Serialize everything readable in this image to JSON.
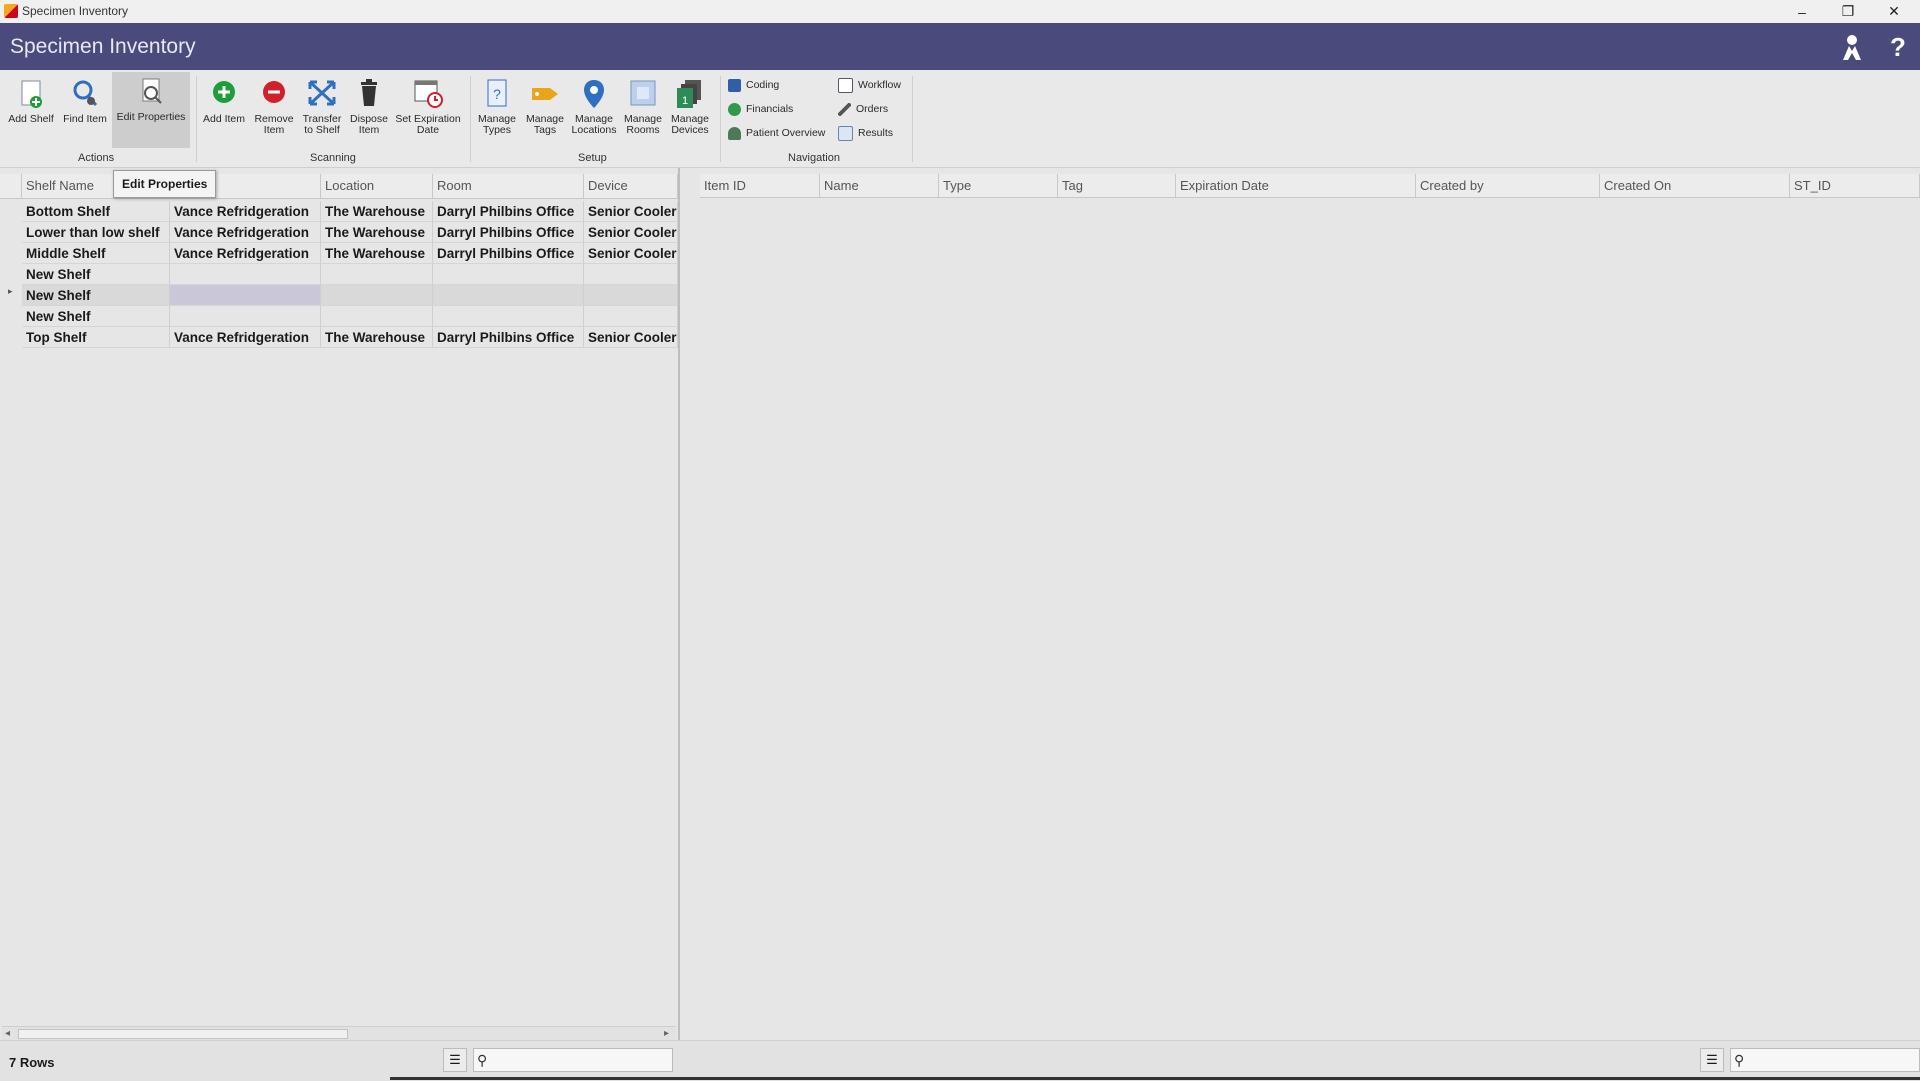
{
  "window": {
    "title": "Specimen Inventory",
    "minimize": "–",
    "maximize": "❐",
    "close": "✕"
  },
  "header": {
    "title": "Specimen Inventory",
    "help": "?"
  },
  "ribbon": {
    "actions": {
      "label": "Actions",
      "buttons": [
        "Add Shelf",
        "Find Item",
        "Edit Properties"
      ]
    },
    "scanning": {
      "label": "Scanning",
      "buttons": [
        "Add Item",
        "Remove\nItem",
        "Transfer\nto Shelf",
        "Dispose\nItem",
        "Set Expiration\nDate"
      ]
    },
    "setup": {
      "label": "Setup",
      "buttons": [
        "Manage\nTypes",
        "Manage\nTags",
        "Manage\nLocations",
        "Manage\nRooms",
        "Manage\nDevices"
      ]
    },
    "navigation": {
      "label": "Navigation",
      "links": [
        "Coding",
        "Financials",
        "Patient Overview",
        "Workflow",
        "Orders",
        "Results"
      ]
    }
  },
  "tooltip": "Edit Properties",
  "shelves": {
    "columns": [
      "Shelf Name",
      "",
      "Location",
      "Room",
      "Device"
    ],
    "rows": [
      [
        "Bottom Shelf",
        "Vance Refridgeration",
        "The Warehouse",
        "Darryl Philbins Office",
        "Senior Cooler"
      ],
      [
        "Lower than low shelf",
        "Vance Refridgeration",
        "The Warehouse",
        "Darryl Philbins Office",
        "Senior Cooler"
      ],
      [
        "Middle Shelf",
        "Vance Refridgeration",
        "The Warehouse",
        "Darryl Philbins Office",
        "Senior Cooler"
      ],
      [
        "New Shelf",
        "",
        "",
        "",
        ""
      ],
      [
        "New Shelf",
        "",
        "",
        "",
        ""
      ],
      [
        "New Shelf",
        "",
        "",
        "",
        ""
      ],
      [
        "Top Shelf",
        "Vance Refridgeration",
        "The Warehouse",
        "Darryl Philbins Office",
        "Senior Cooler"
      ]
    ],
    "selected_row": 4
  },
  "items": {
    "columns": [
      "Item ID",
      "Name",
      "Type",
      "Tag",
      "Expiration Date",
      "Created by",
      "Created On",
      "ST_ID"
    ]
  },
  "status": {
    "row_count": "7 Rows",
    "search_left": "",
    "search_right": ""
  },
  "colors": {
    "header_bg": "#4a4a7c",
    "add_green": "#1e9e3a",
    "remove_red": "#d0202a",
    "accent_blue": "#2f6fc2"
  }
}
